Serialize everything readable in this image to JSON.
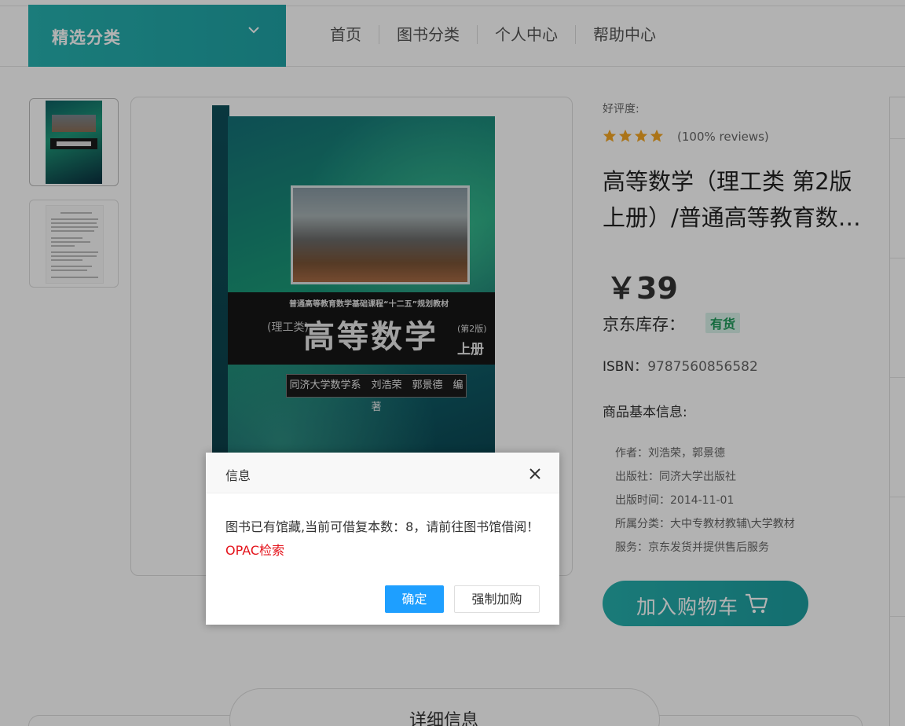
{
  "header": {
    "category_label": "精选分类",
    "nav": [
      {
        "label": "首页"
      },
      {
        "label": "图书分类"
      },
      {
        "label": "个人中心"
      },
      {
        "label": "帮助中心"
      }
    ]
  },
  "cover": {
    "subtitle": "普通高等教育数学基础课程“十二五”规划教材",
    "title": "高等数学",
    "category": "(理工类)",
    "edition": "(第2版)",
    "volume": "上册",
    "authors": "同济大学数学系　刘浩荣　郭景德　编著"
  },
  "product": {
    "rating_label": "好评度:",
    "stars": 4,
    "reviews": "(100% reviews)",
    "title_line1": "高等数学（理工类 第2版",
    "title_line2": "上册）/普通高等教育数学基础课程“十二五”规划教材",
    "price": "￥39",
    "stock_label": "京东库存：",
    "stock_status": "有货",
    "isbn_label": "ISBN：",
    "isbn": "9787560856582",
    "basic_info_label": "商品基本信息:",
    "meta": [
      "作者：刘浩荣，郭景德",
      "出版社：同济大学出版社",
      "出版时间：2014-11-01",
      "所属分类：大中专教材教辅\\大学教材",
      "服务：京东发货并提供售后服务"
    ],
    "cart_button": "加入购物车"
  },
  "detail_tab": "详细信息",
  "dialog": {
    "title": "信息",
    "message": "图书已有馆藏,当前可借复本数：8，请前往图书馆借阅！",
    "link": "OPAC检索",
    "ok": "确定",
    "force": "强制加购"
  },
  "colors": {
    "accent": "#23aaa9",
    "dialog_ok": "#1e9fff",
    "link": "#e4121a",
    "star": "#f5a623"
  }
}
